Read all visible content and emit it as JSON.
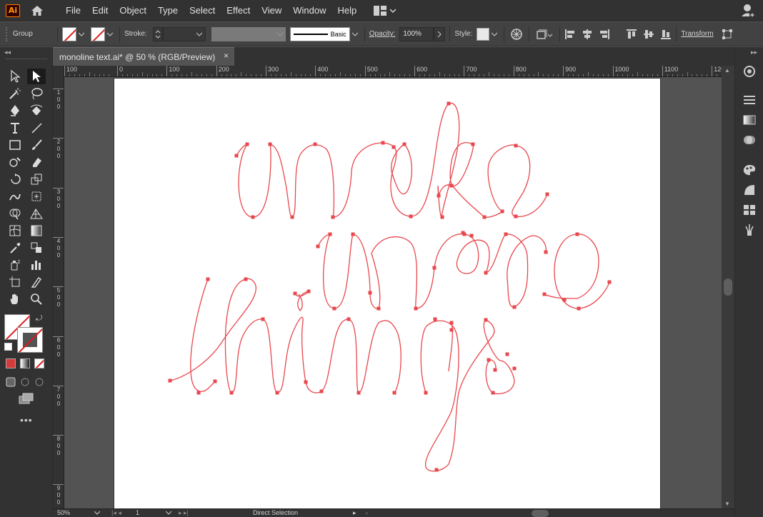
{
  "app": {
    "logo_text": "Ai"
  },
  "menu": [
    "File",
    "Edit",
    "Object",
    "Type",
    "Select",
    "Effect",
    "View",
    "Window",
    "Help"
  ],
  "control_bar": {
    "selection_label": "Group",
    "stroke_label": "Stroke:",
    "brush_label": "Basic",
    "opacity_label": "Opacity:",
    "opacity_value": "100%",
    "style_label": "Style:",
    "transform_label": "Transform"
  },
  "document_tab": {
    "title": "monoline text.ai* @ 50 % (RGB/Preview)",
    "close_glyph": "×"
  },
  "ruler": {
    "h_labels": [
      "100",
      "0",
      "100",
      "200",
      "300",
      "400",
      "500",
      "600",
      "700",
      "800",
      "900",
      "1000",
      "1100",
      "120"
    ],
    "v_labels": [
      "1\n0\n0",
      "2\n0\n0",
      "3\n0\n0",
      "4\n0\n0",
      "5\n0\n0",
      "6\n0\n0",
      "7\n0\n0",
      "8\n0\n0",
      "9\n0\n0"
    ]
  },
  "status_bar": {
    "zoom": "50%",
    "artboard_number": "1",
    "tool_name": "Direct Selection"
  },
  "artwork": {
    "lines": [
      "make",
      "more",
      "things"
    ],
    "stroke_color": "#e8474d"
  },
  "colors": {
    "accent": "#e8474d",
    "ui_dark": "#323232",
    "canvas_bg": "#535353",
    "artboard": "#ffffff"
  }
}
